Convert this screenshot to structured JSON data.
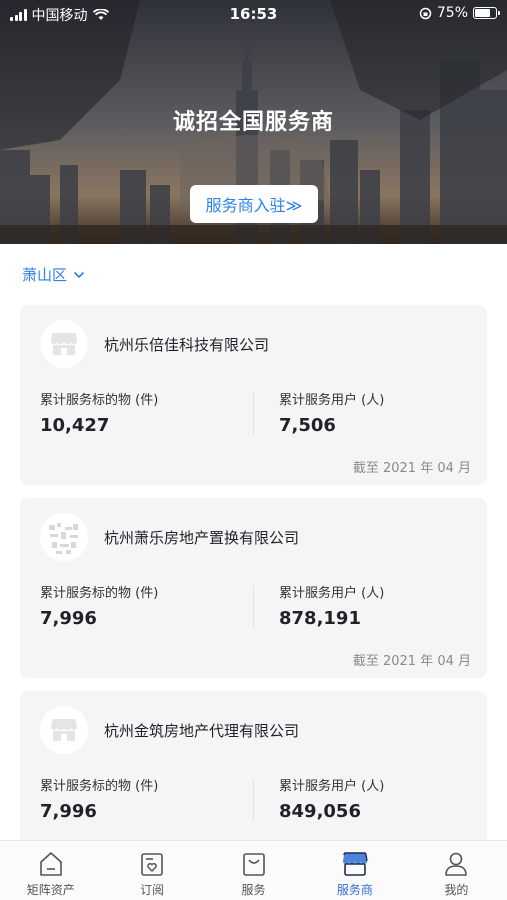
{
  "status_bar": {
    "carrier": "中国移动",
    "time": "16:53",
    "battery": "75%",
    "battery_level": 0.75
  },
  "hero": {
    "title": "诚招全国服务商",
    "join_button": "服务商入驻≫"
  },
  "region": {
    "label": "萧山区"
  },
  "cards": [
    {
      "name": "杭州乐倍佳科技有限公司",
      "label_items": "累计服务标的物 (件)",
      "value_items": "10,427",
      "label_users": "累计服务用户 (人)",
      "value_users": "7,506",
      "date": "截至 2021 年 04 月"
    },
    {
      "name": "杭州萧乐房地产置换有限公司",
      "label_items": "累计服务标的物 (件)",
      "value_items": "7,996",
      "label_users": "累计服务用户 (人)",
      "value_users": "878,191",
      "date": "截至 2021 年 04 月"
    },
    {
      "name": "杭州金筑房地产代理有限公司",
      "label_items": "累计服务标的物 (件)",
      "value_items": "7,996",
      "label_users": "累计服务用户 (人)",
      "value_users": "849,056"
    }
  ],
  "tabs": [
    {
      "label": "矩阵资产",
      "icon": "home-icon"
    },
    {
      "label": "订阅",
      "icon": "subscribe-icon"
    },
    {
      "label": "服务",
      "icon": "bag-icon"
    },
    {
      "label": "服务商",
      "icon": "store-icon",
      "active": true
    },
    {
      "label": "我的",
      "icon": "user-icon"
    }
  ],
  "colors": {
    "accent": "#2f80ed",
    "tab_active": "#2f6fd6",
    "card_bg": "#f5f5f5"
  }
}
